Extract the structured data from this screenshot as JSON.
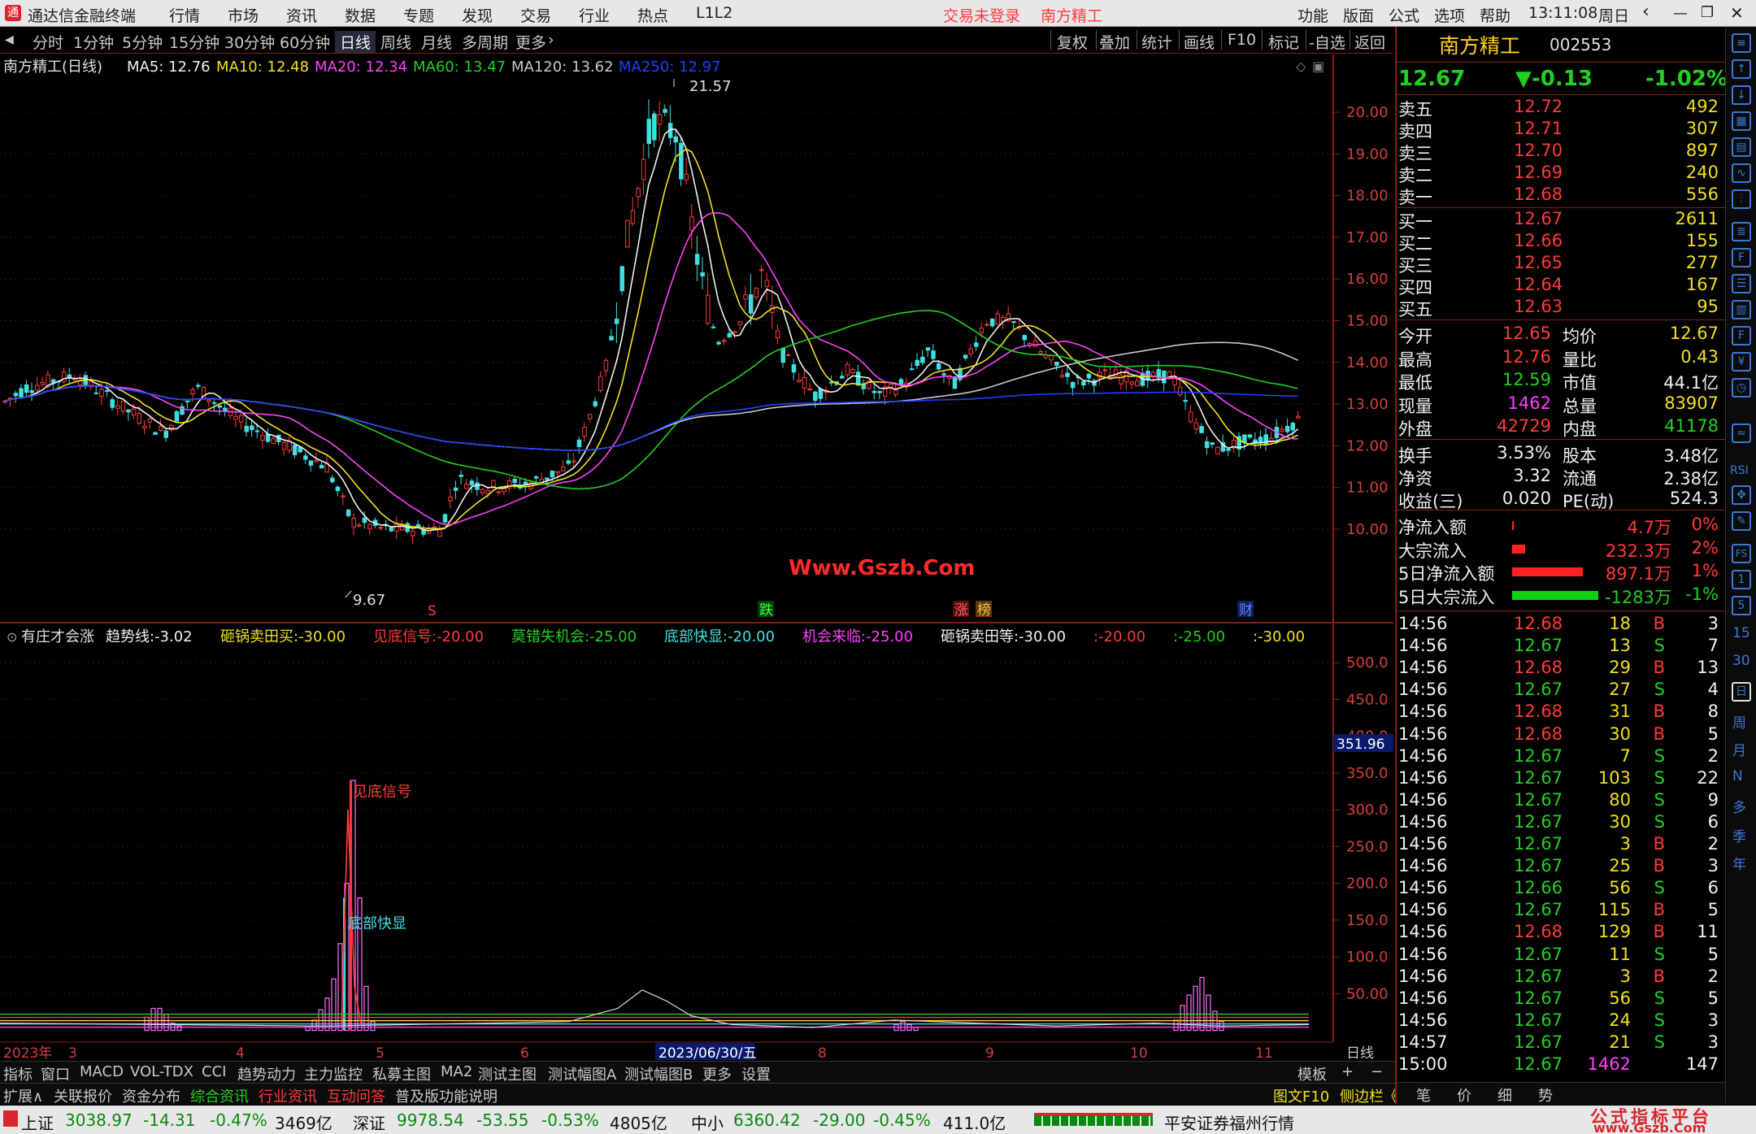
{
  "app": {
    "title": "通达信金融终端",
    "menus": [
      "行情",
      "市场",
      "资讯",
      "数据",
      "专题",
      "发现",
      "交易",
      "行业",
      "热点",
      "L1L2"
    ],
    "login_status": "交易未登录",
    "stock_title": "南方精工",
    "right_menus": [
      "功能",
      "版面",
      "公式",
      "选项",
      "帮助"
    ],
    "clock": "13:11:08",
    "weekday": "周日"
  },
  "periods": {
    "items": [
      "分时",
      "1分钟",
      "5分钟",
      "15分钟",
      "30分钟",
      "60分钟",
      "日线",
      "周线",
      "月线",
      "多周期",
      "更多"
    ],
    "selected": "日线",
    "tools": [
      "复权",
      "叠加",
      "统计",
      "画线",
      "F10",
      "标记",
      "-自选",
      "返回"
    ]
  },
  "kline": {
    "stock_label": "南方精工(日线)",
    "ma": [
      {
        "name": "MA5",
        "value": "12.76",
        "color": "#f0f0f0"
      },
      {
        "name": "MA10",
        "value": "12.48",
        "color": "#f0e020"
      },
      {
        "name": "MA20",
        "value": "12.34",
        "color": "#ff40ff"
      },
      {
        "name": "MA60",
        "value": "13.47",
        "color": "#22d022"
      },
      {
        "name": "MA120",
        "value": "13.62",
        "color": "#c8c8c8"
      },
      {
        "name": "MA250",
        "value": "12.97",
        "color": "#2040ff"
      }
    ],
    "y_ticks": [
      "20.00",
      "19.00",
      "18.00",
      "17.00",
      "16.00",
      "15.00",
      "14.00",
      "13.00",
      "12.00",
      "11.00",
      "10.00"
    ],
    "high_label": "21.57",
    "low_label": "9.67",
    "watermark": "Www.Gszb.Com",
    "event_markers": [
      "S",
      "跌",
      "涨",
      "榜",
      "财"
    ]
  },
  "indicator": {
    "name": "有庄才会涨",
    "items": [
      {
        "label": "趋势线:",
        "value": "-3.02",
        "color": "#f0f0f0"
      },
      {
        "label": "砸锅卖田买:",
        "value": "-30.00",
        "color": "#f0e020"
      },
      {
        "label": "见底信号:",
        "value": "-20.00",
        "color": "#ff3a3a"
      },
      {
        "label": "莫错失机会:",
        "value": "-25.00",
        "color": "#22d022"
      },
      {
        "label": "底部快显:",
        "value": "-20.00",
        "color": "#40e0e0"
      },
      {
        "label": "机会来临:",
        "value": "-25.00",
        "color": "#ff40ff"
      },
      {
        "label": "砸锅卖田等:",
        "value": "-30.00",
        "color": "#f0f0f0"
      },
      {
        "label": ":",
        "value": "-20.00",
        "color": "#ff3a3a"
      },
      {
        "label": ":",
        "value": "-25.00",
        "color": "#22d022"
      },
      {
        "label": ":",
        "value": "-30.00",
        "color": "#f0e020"
      }
    ],
    "y_ticks": [
      "500.0",
      "450.0",
      "400.0",
      "350.0",
      "300.0",
      "250.0",
      "200.0",
      "150.0",
      "100.0",
      "50.00"
    ],
    "cursor_value": "351.96",
    "annotations": [
      "见底信号",
      "底部快显"
    ]
  },
  "xaxis": {
    "labels": [
      "2023年",
      "3",
      "4",
      "5",
      "6",
      "2023/06/30/五",
      "7",
      "8",
      "9",
      "10",
      "11"
    ],
    "period_label": "日线"
  },
  "tabs": {
    "items": [
      "指标",
      "窗口",
      "MACD",
      "VOL-TDX",
      "CCI",
      "趋势动力",
      "主力监控",
      "私募主图",
      "MA2",
      "测试主图",
      "测试幅图A",
      "测试幅图B",
      "更多",
      "设置"
    ],
    "right": [
      "模板",
      "+",
      "−"
    ]
  },
  "ext_tabs": {
    "items": [
      "扩展∧",
      "关联报价",
      "资金分布",
      "综合资讯",
      "行业资讯",
      "互动问答",
      "普及版功能说明"
    ],
    "right": [
      "图文F10",
      "侧边栏《"
    ]
  },
  "quote": {
    "name": "南方精工",
    "code": "002553",
    "price": "12.67",
    "change": "▼-0.13",
    "change_pct": "-1.02%",
    "asks": [
      {
        "label": "卖五",
        "price": "12.72",
        "vol": "492"
      },
      {
        "label": "卖四",
        "price": "12.71",
        "vol": "307"
      },
      {
        "label": "卖三",
        "price": "12.70",
        "vol": "897"
      },
      {
        "label": "卖二",
        "price": "12.69",
        "vol": "240"
      },
      {
        "label": "卖一",
        "price": "12.68",
        "vol": "556"
      }
    ],
    "bids": [
      {
        "label": "买一",
        "price": "12.67",
        "vol": "2611"
      },
      {
        "label": "买二",
        "price": "12.66",
        "vol": "155"
      },
      {
        "label": "买三",
        "price": "12.65",
        "vol": "277"
      },
      {
        "label": "买四",
        "price": "12.64",
        "vol": "167"
      },
      {
        "label": "买五",
        "price": "12.63",
        "vol": "95"
      }
    ],
    "stats": [
      {
        "l1": "今开",
        "v1": "12.65",
        "c1": "#ff3a3a",
        "l2": "均价",
        "v2": "12.67",
        "c2": "#f0e020"
      },
      {
        "l1": "最高",
        "v1": "12.76",
        "c1": "#ff3a3a",
        "l2": "量比",
        "v2": "0.43",
        "c2": "#f0e020"
      },
      {
        "l1": "最低",
        "v1": "12.59",
        "c1": "#22d022",
        "l2": "市值",
        "v2": "44.1亿",
        "c2": "#f0f0f0"
      },
      {
        "l1": "现量",
        "v1": "1462",
        "c1": "#ff40ff",
        "l2": "总量",
        "v2": "83907",
        "c2": "#f0e020"
      },
      {
        "l1": "外盘",
        "v1": "42729",
        "c1": "#ff3a3a",
        "l2": "内盘",
        "v2": "41178",
        "c2": "#22d022"
      }
    ],
    "stats2": [
      {
        "l1": "换手",
        "v1": "3.53%",
        "l2": "股本",
        "v2": "3.48亿"
      },
      {
        "l1": "净资",
        "v1": "3.32",
        "l2": "流通",
        "v2": "2.38亿"
      },
      {
        "l1": "收益(三)",
        "v1": "0.020",
        "l2": "PE(动)",
        "v2": "524.3"
      }
    ],
    "flows": [
      {
        "label": "净流入额",
        "value": "4.7万",
        "pct": "0%",
        "color": "#ff3a3a",
        "bar": 0.02
      },
      {
        "label": "大宗流入",
        "value": "232.3万",
        "pct": "2%",
        "color": "#ff3a3a",
        "bar": 0.15
      },
      {
        "label": "5日净流入额",
        "value": "897.1万",
        "pct": "1%",
        "color": "#ff3a3a",
        "bar": 0.82
      },
      {
        "label": "5日大宗流入",
        "value": "-1283万",
        "pct": "-1%",
        "color": "#22d022",
        "bar": 1.0
      }
    ],
    "ticks": [
      {
        "t": "14:56",
        "p": "12.68",
        "v": "18",
        "s": "B",
        "n": "3"
      },
      {
        "t": "14:56",
        "p": "12.67",
        "v": "13",
        "s": "S",
        "n": "7"
      },
      {
        "t": "14:56",
        "p": "12.68",
        "v": "29",
        "s": "B",
        "n": "13"
      },
      {
        "t": "14:56",
        "p": "12.67",
        "v": "27",
        "s": "S",
        "n": "4"
      },
      {
        "t": "14:56",
        "p": "12.68",
        "v": "31",
        "s": "B",
        "n": "8"
      },
      {
        "t": "14:56",
        "p": "12.68",
        "v": "30",
        "s": "B",
        "n": "5"
      },
      {
        "t": "14:56",
        "p": "12.67",
        "v": "7",
        "s": "S",
        "n": "2"
      },
      {
        "t": "14:56",
        "p": "12.67",
        "v": "103",
        "s": "S",
        "n": "22"
      },
      {
        "t": "14:56",
        "p": "12.67",
        "v": "80",
        "s": "S",
        "n": "9"
      },
      {
        "t": "14:56",
        "p": "12.67",
        "v": "30",
        "s": "S",
        "n": "6"
      },
      {
        "t": "14:56",
        "p": "12.67",
        "v": "3",
        "s": "B",
        "n": "2"
      },
      {
        "t": "14:56",
        "p": "12.67",
        "v": "25",
        "s": "B",
        "n": "3"
      },
      {
        "t": "14:56",
        "p": "12.66",
        "v": "56",
        "s": "S",
        "n": "6"
      },
      {
        "t": "14:56",
        "p": "12.67",
        "v": "115",
        "s": "B",
        "n": "5"
      },
      {
        "t": "14:56",
        "p": "12.68",
        "v": "129",
        "s": "B",
        "n": "11"
      },
      {
        "t": "14:56",
        "p": "12.67",
        "v": "11",
        "s": "S",
        "n": "5"
      },
      {
        "t": "14:56",
        "p": "12.67",
        "v": "3",
        "s": "B",
        "n": "2"
      },
      {
        "t": "14:56",
        "p": "12.67",
        "v": "56",
        "s": "S",
        "n": "5"
      },
      {
        "t": "14:56",
        "p": "12.67",
        "v": "24",
        "s": "S",
        "n": "3"
      },
      {
        "t": "14:57",
        "p": "12.67",
        "v": "21",
        "s": "S",
        "n": "3"
      },
      {
        "t": "15:00",
        "p": "12.67",
        "v": "1462",
        "s": "",
        "n": "147"
      }
    ],
    "bottom_tabs": [
      "笔",
      "价",
      "细",
      "势"
    ]
  },
  "side_icons": {
    "labels": [
      "RSI",
      "FS",
      "15",
      "30",
      "日",
      "周",
      "月",
      "N",
      "多",
      "季",
      "年"
    ]
  },
  "status": {
    "indices": [
      {
        "name": "上证",
        "value": "3038.97",
        "chg": "-14.31",
        "pct": "-0.47%",
        "amt": "3469亿"
      },
      {
        "name": "深证",
        "value": "9978.54",
        "chg": "-53.55",
        "pct": "-0.53%",
        "amt": "4805亿"
      },
      {
        "name": "中小",
        "value": "6360.42",
        "chg": "-29.00",
        "pct": "-0.45%",
        "amt": "411.0亿"
      }
    ],
    "broker": "平安证券福州行情",
    "brand": "公式指标平台",
    "brand_url": "www.Gszb.Com"
  }
}
